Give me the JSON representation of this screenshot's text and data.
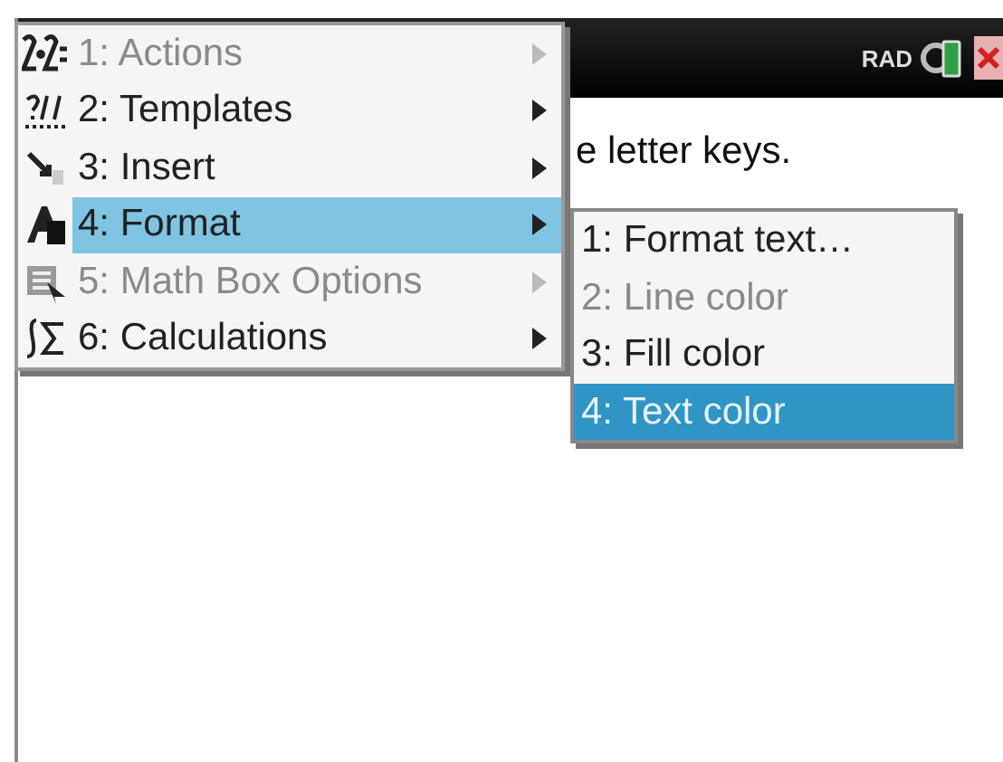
{
  "status_bar": {
    "mode": "RAD"
  },
  "document": {
    "text": "e letter keys."
  },
  "menu": {
    "items": [
      {
        "label": "1: Actions",
        "disabled": true,
        "selected": false
      },
      {
        "label": "2: Templates",
        "disabled": false,
        "selected": false
      },
      {
        "label": "3: Insert",
        "disabled": false,
        "selected": false
      },
      {
        "label": "4: Format",
        "disabled": false,
        "selected": true
      },
      {
        "label": "5: Math Box Options",
        "disabled": true,
        "selected": false
      },
      {
        "label": "6: Calculations",
        "disabled": false,
        "selected": false
      }
    ]
  },
  "submenu": {
    "items": [
      {
        "label": "1: Format text…",
        "disabled": false,
        "selected": false
      },
      {
        "label": "2: Line color",
        "disabled": true,
        "selected": false
      },
      {
        "label": "3: Fill color",
        "disabled": false,
        "selected": false
      },
      {
        "label": "4: Text color",
        "disabled": false,
        "selected": true
      }
    ]
  }
}
